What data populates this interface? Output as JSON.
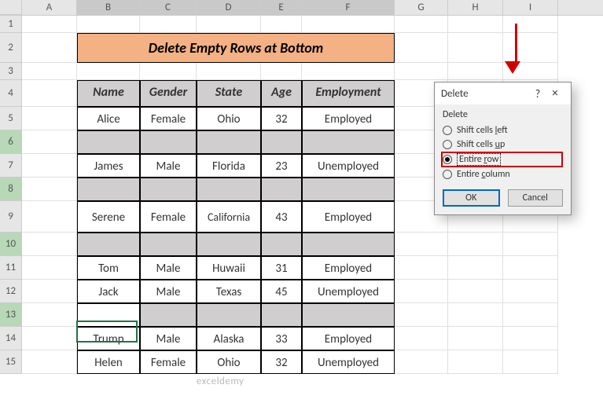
{
  "columns": [
    "A",
    "B",
    "C",
    "D",
    "E",
    "F",
    "G",
    "H",
    "I"
  ],
  "row_numbers": [
    1,
    2,
    3,
    4,
    5,
    6,
    7,
    8,
    9,
    10,
    11,
    12,
    13,
    14,
    15
  ],
  "highlighted_column_headers": [
    "B",
    "C",
    "D",
    "E",
    "F"
  ],
  "highlighted_row_headers": [
    6,
    8,
    10,
    13
  ],
  "title": "Delete Empty Rows at Bottom",
  "headers": {
    "B": "Name",
    "C": "Gender",
    "D": "State",
    "E": "Age",
    "F": "Employment"
  },
  "data_rows": [
    {
      "r": 5,
      "B": "Alice",
      "C": "Female",
      "D": "Ohio",
      "E": "32",
      "F": "Employed"
    },
    {
      "r": 7,
      "B": "James",
      "C": "Male",
      "D": "Florida",
      "E": "23",
      "F": "Unemployed"
    },
    {
      "r": 9,
      "B": "Serene",
      "C": "Female",
      "D": "California",
      "E": "43",
      "F": "Employed"
    },
    {
      "r": 11,
      "B": "Tom",
      "C": "Male",
      "D": "Huwaii",
      "E": "31",
      "F": "Employed"
    },
    {
      "r": 12,
      "B": "Jack",
      "C": "Male",
      "D": "Texas",
      "E": "45",
      "F": "Unemployed"
    },
    {
      "r": 14,
      "B": "Trump",
      "C": "Male",
      "D": "Alaska",
      "E": "33",
      "F": "Employed"
    },
    {
      "r": 15,
      "B": "Helen",
      "C": "Female",
      "D": "Ohio",
      "E": "32",
      "F": "Unemployed"
    }
  ],
  "empty_rows": [
    6,
    8,
    10,
    13
  ],
  "active_cell_row": 13,
  "dialog": {
    "title": "Delete",
    "section": "Delete",
    "options": {
      "shift_left": "Shift cells left",
      "shift_up": "Shift cells up",
      "entire_row": "Entire row",
      "entire_column": "Entire column"
    },
    "selected": "entire_row",
    "ok": "OK",
    "cancel": "Cancel"
  },
  "watermark": "exceldemy"
}
